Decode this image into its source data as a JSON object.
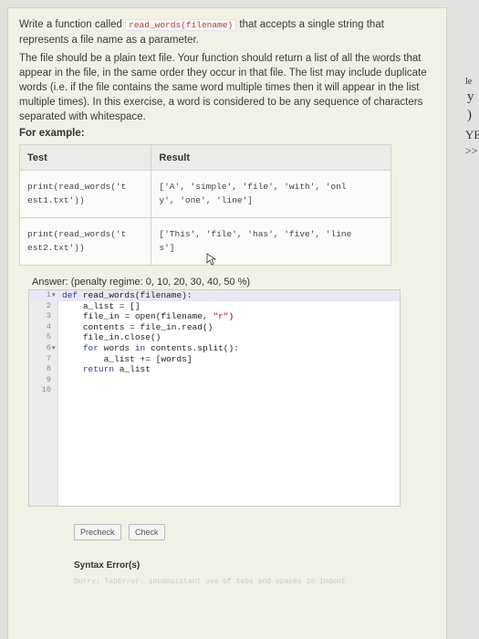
{
  "question": {
    "intro_before": "Write a function called",
    "function_signature": "read_words(filename)",
    "intro_after": "that accepts a single string that represents a file name as a parameter.",
    "description": "The file should be a plain text file. Your function should return a list of all the words that appear in the file, in the same order they occur in that file. The list may include duplicate words (i.e. if the file contains the same word multiple times then it will appear in the list multiple times). In this exercise, a word is considered to be any sequence of characters separated with whitespace.",
    "for_example_label": "For example:"
  },
  "examples_table": {
    "headers": [
      "Test",
      "Result"
    ],
    "rows": [
      {
        "test_line1": "print(read_words('t",
        "test_line2": "est1.txt'))",
        "result_line1": "['A', 'simple', 'file', 'with', 'onl",
        "result_line2": "y', 'one', 'line']"
      },
      {
        "test_line1": "print(read_words('t",
        "test_line2": "est2.txt'))",
        "result_line1": "['This', 'file', 'has', 'five', 'line",
        "result_line2": "s']"
      }
    ]
  },
  "answer": {
    "label": "Answer: (penalty regime: 0, 10, 20, 30, 40, 50 %)",
    "code_lines": [
      {
        "num": "1",
        "fold": "▾",
        "code": "def read_words(filename):"
      },
      {
        "num": "2",
        "fold": "",
        "code": "    a_list = []"
      },
      {
        "num": "3",
        "fold": "",
        "code": "    file_in = open(filename, \"r\")"
      },
      {
        "num": "4",
        "fold": "",
        "code": "    contents = file_in.read()"
      },
      {
        "num": "5",
        "fold": "",
        "code": "    file_in.close()"
      },
      {
        "num": "6",
        "fold": "▾",
        "code": "    for words in contents.split():"
      },
      {
        "num": "7",
        "fold": "",
        "code": "        a_list += [words]"
      },
      {
        "num": "8",
        "fold": "",
        "code": "    return a_list"
      },
      {
        "num": "9",
        "fold": "",
        "code": ""
      },
      {
        "num": "10",
        "fold": "",
        "code": ""
      }
    ]
  },
  "buttons": {
    "precheck": "Precheck",
    "check": "Check"
  },
  "syntax_error": {
    "title": "Syntax Error(s)",
    "message": "Sorry: TabError: inconsistent use of tabs and spaces in indent"
  },
  "right_strip": {
    "frag1": "le",
    "frag2": "y",
    "frag3": ")",
    "frag4": "YE",
    "frag5": ">>"
  }
}
